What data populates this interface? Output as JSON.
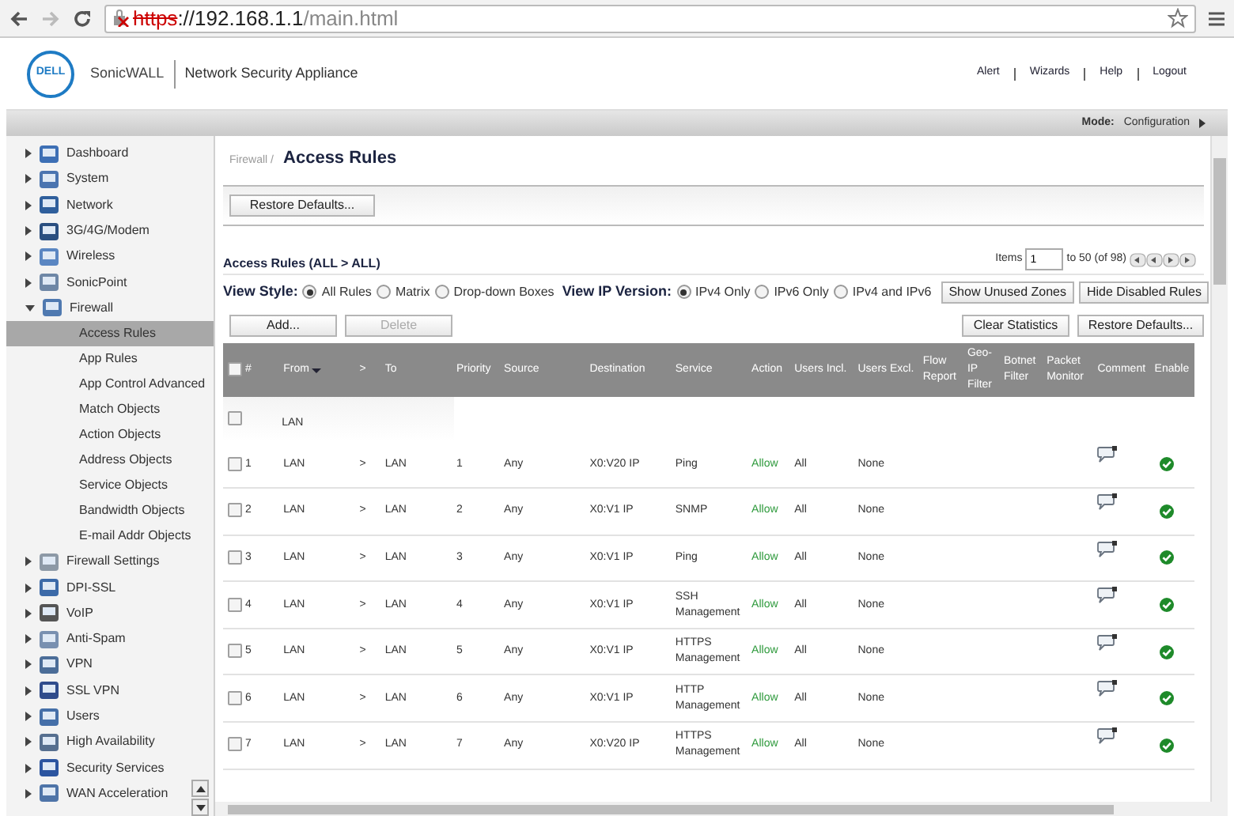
{
  "browser": {
    "insecure": true,
    "scheme": "https",
    "host": "://192.168.1.1",
    "path": "/main.html"
  },
  "header": {
    "logo": "DELL",
    "brand": "SonicWALL",
    "product": "Network Security Appliance",
    "links": [
      "Alert",
      "Wizards",
      "Help",
      "Logout"
    ]
  },
  "mode_bar": {
    "label": "Mode:",
    "value": "Configuration"
  },
  "sidebar": {
    "items": [
      {
        "label": "Dashboard",
        "expanded": false,
        "selected": false
      },
      {
        "label": "System",
        "expanded": false,
        "selected": false
      },
      {
        "label": "Network",
        "expanded": false,
        "selected": false
      },
      {
        "label": "3G/4G/Modem",
        "expanded": false,
        "selected": false
      },
      {
        "label": "Wireless",
        "expanded": false,
        "selected": false
      },
      {
        "label": "SonicPoint",
        "expanded": false,
        "selected": false
      },
      {
        "label": "Firewall",
        "expanded": true,
        "selected": false,
        "children": [
          {
            "label": "Access Rules",
            "selected": true
          },
          {
            "label": "App Rules",
            "selected": false
          },
          {
            "label": "App Control Advanced",
            "selected": false
          },
          {
            "label": "Match Objects",
            "selected": false
          },
          {
            "label": "Action Objects",
            "selected": false
          },
          {
            "label": "Address Objects",
            "selected": false
          },
          {
            "label": "Service Objects",
            "selected": false
          },
          {
            "label": "Bandwidth Objects",
            "selected": false
          },
          {
            "label": "E-mail Addr Objects",
            "selected": false
          }
        ]
      },
      {
        "label": "Firewall Settings",
        "expanded": false,
        "selected": false
      },
      {
        "label": "DPI-SSL",
        "expanded": false,
        "selected": false
      },
      {
        "label": "VoIP",
        "expanded": false,
        "selected": false
      },
      {
        "label": "Anti-Spam",
        "expanded": false,
        "selected": false
      },
      {
        "label": "VPN",
        "expanded": false,
        "selected": false
      },
      {
        "label": "SSL VPN",
        "expanded": false,
        "selected": false
      },
      {
        "label": "Users",
        "expanded": false,
        "selected": false
      },
      {
        "label": "High Availability",
        "expanded": false,
        "selected": false
      },
      {
        "label": "Security Services",
        "expanded": false,
        "selected": false
      },
      {
        "label": "WAN Acceleration",
        "expanded": false,
        "selected": false
      }
    ]
  },
  "page": {
    "breadcrumb": "Firewall /",
    "title": "Access Rules",
    "top_button": "Restore Defaults...",
    "section_title": "Access Rules (ALL > ALL)",
    "pager": {
      "label": "Items",
      "value": "1",
      "range": "to 50 (of 98)"
    },
    "view_style": {
      "label": "View Style:",
      "options": [
        {
          "label": "All Rules",
          "selected": true
        },
        {
          "label": "Matrix",
          "selected": false
        },
        {
          "label": "Drop-down Boxes",
          "selected": false
        }
      ]
    },
    "ip_version": {
      "label": "View IP Version:",
      "options": [
        {
          "label": "IPv4 Only",
          "selected": true
        },
        {
          "label": "IPv6 Only",
          "selected": false
        },
        {
          "label": "IPv4 and IPv6",
          "selected": false
        }
      ]
    },
    "view_buttons": [
      "Show Unused Zones",
      "Hide Disabled Rules"
    ],
    "left_buttons": [
      {
        "label": "Add...",
        "disabled": false
      },
      {
        "label": "Delete",
        "disabled": true
      }
    ],
    "right_buttons": [
      "Clear Statistics",
      "Restore Defaults..."
    ]
  },
  "table": {
    "columns": [
      "#",
      "From",
      ">",
      "To",
      "Priority",
      "Source",
      "Destination",
      "Service",
      "Action",
      "Users Incl.",
      "Users Excl.",
      "Flow Report",
      "Geo-IP Filter",
      "Botnet Filter",
      "Packet Monitor",
      "Comment",
      "Enable"
    ],
    "select_all": {
      "checked": false
    },
    "group": {
      "label": "LAN",
      "checked": false
    },
    "rows": [
      {
        "checked": false,
        "num": "1",
        "from": "LAN",
        "arrow": ">",
        "to": "LAN",
        "priority": "1",
        "source": "Any",
        "destination": "X0:V20 IP",
        "service": "Ping",
        "action": "Allow",
        "users_incl": "All",
        "users_excl": "None",
        "enabled": true
      },
      {
        "checked": false,
        "num": "2",
        "from": "LAN",
        "arrow": ">",
        "to": "LAN",
        "priority": "2",
        "source": "Any",
        "destination": "X0:V1 IP",
        "service": "SNMP",
        "action": "Allow",
        "users_incl": "All",
        "users_excl": "None",
        "enabled": true
      },
      {
        "checked": false,
        "num": "3",
        "from": "LAN",
        "arrow": ">",
        "to": "LAN",
        "priority": "3",
        "source": "Any",
        "destination": "X0:V1 IP",
        "service": "Ping",
        "action": "Allow",
        "users_incl": "All",
        "users_excl": "None",
        "enabled": true
      },
      {
        "checked": false,
        "num": "4",
        "from": "LAN",
        "arrow": ">",
        "to": "LAN",
        "priority": "4",
        "source": "Any",
        "destination": "X0:V1 IP",
        "service": "SSH Management",
        "action": "Allow",
        "users_incl": "All",
        "users_excl": "None",
        "enabled": true
      },
      {
        "checked": false,
        "num": "5",
        "from": "LAN",
        "arrow": ">",
        "to": "LAN",
        "priority": "5",
        "source": "Any",
        "destination": "X0:V1 IP",
        "service": "HTTPS Management",
        "action": "Allow",
        "users_incl": "All",
        "users_excl": "None",
        "enabled": true
      },
      {
        "checked": false,
        "num": "6",
        "from": "LAN",
        "arrow": ">",
        "to": "LAN",
        "priority": "6",
        "source": "Any",
        "destination": "X0:V1 IP",
        "service": "HTTP Management",
        "action": "Allow",
        "users_incl": "All",
        "users_excl": "None",
        "enabled": true
      },
      {
        "checked": false,
        "num": "7",
        "from": "LAN",
        "arrow": ">",
        "to": "LAN",
        "priority": "7",
        "source": "Any",
        "destination": "X0:V20 IP",
        "service": "HTTPS Management",
        "action": "Allow",
        "users_incl": "All",
        "users_excl": "None",
        "enabled": true
      }
    ]
  }
}
